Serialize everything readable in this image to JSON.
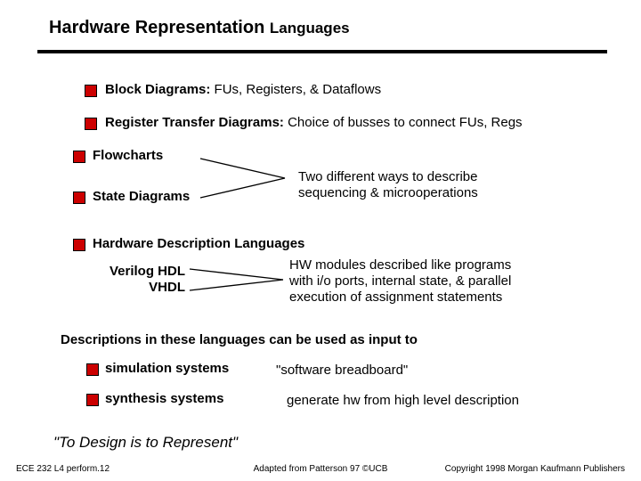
{
  "title": {
    "main": "Hardware Representation ",
    "lang": "Languages"
  },
  "items": {
    "block_bold": "Block Diagrams:",
    "block_rest": "  FUs, Registers, & Dataflows",
    "rtd_bold": "Register Transfer Diagrams:",
    "rtd_rest": "  Choice of busses to connect FUs, Regs",
    "flowcharts": "Flowcharts",
    "state": "State Diagrams",
    "seq_desc_l1": "Two different ways to describe",
    "seq_desc_l2": "sequencing & microoperations",
    "hdl_heading": "Hardware Description Languages",
    "verilog": "Verilog HDL",
    "vhdl": "VHDL",
    "hdl_desc_l1": "HW modules described like programs",
    "hdl_desc_l2": "with i/o ports, internal state, & parallel",
    "hdl_desc_l3": "execution of assignment statements",
    "desc_intro": "Descriptions in these languages can be used as input to",
    "sim": "simulation systems",
    "sim_desc": "\"software breadboard\"",
    "syn": "synthesis systems",
    "syn_desc": "generate hw from high level description",
    "quote": "\"To Design is to Represent\""
  },
  "footer": {
    "left": "ECE 232  L4 perform.12",
    "center": "Adapted from Patterson 97 ©UCB",
    "right": "Copyright 1998 Morgan Kaufmann Publishers"
  }
}
